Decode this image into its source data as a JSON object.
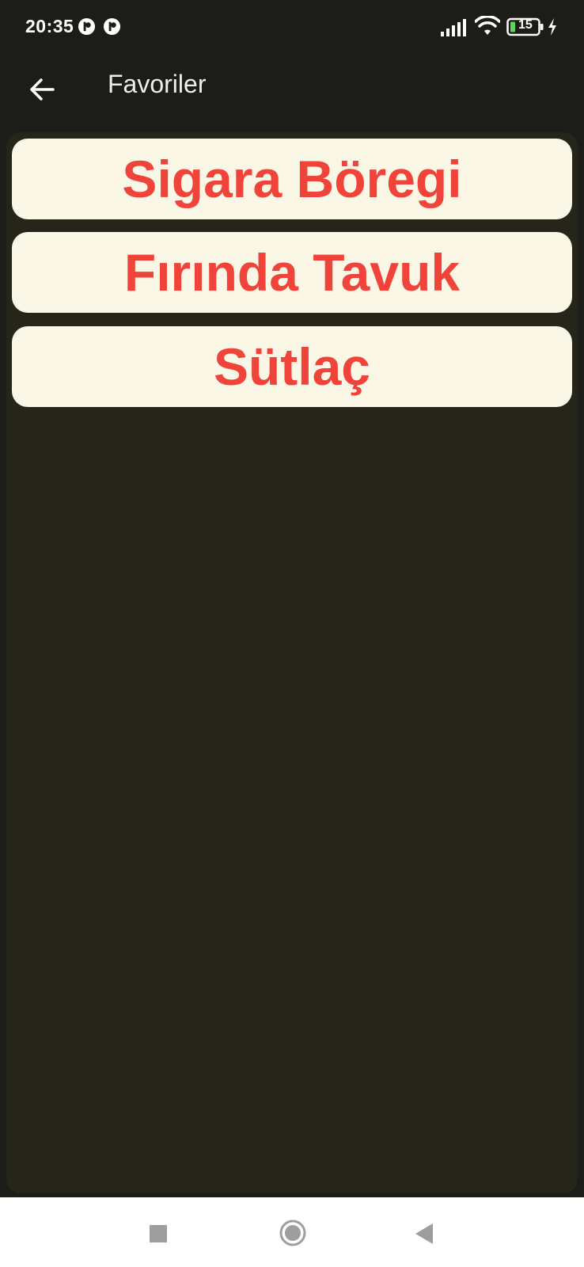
{
  "status_bar": {
    "time": "20:35",
    "battery_level": "15",
    "icons": [
      "notification-icon",
      "notification-icon",
      "signal-icon",
      "wifi-icon",
      "battery-icon",
      "charging-icon"
    ]
  },
  "app_bar": {
    "title": "Favoriler",
    "back_icon": "arrow-left-icon"
  },
  "favorites": [
    {
      "label": "Sigara Böregi"
    },
    {
      "label": "Fırında Tavuk"
    },
    {
      "label": "Sütlaç"
    }
  ],
  "nav_bar": {
    "icons": [
      "recents-square-icon",
      "home-circle-icon",
      "back-triangle-icon"
    ]
  },
  "colors": {
    "background": "#1c1c18",
    "panel": "#25251a",
    "card": "#faf7e6",
    "accent_text": "#f0443a",
    "battery_fill": "#5cd65c"
  }
}
